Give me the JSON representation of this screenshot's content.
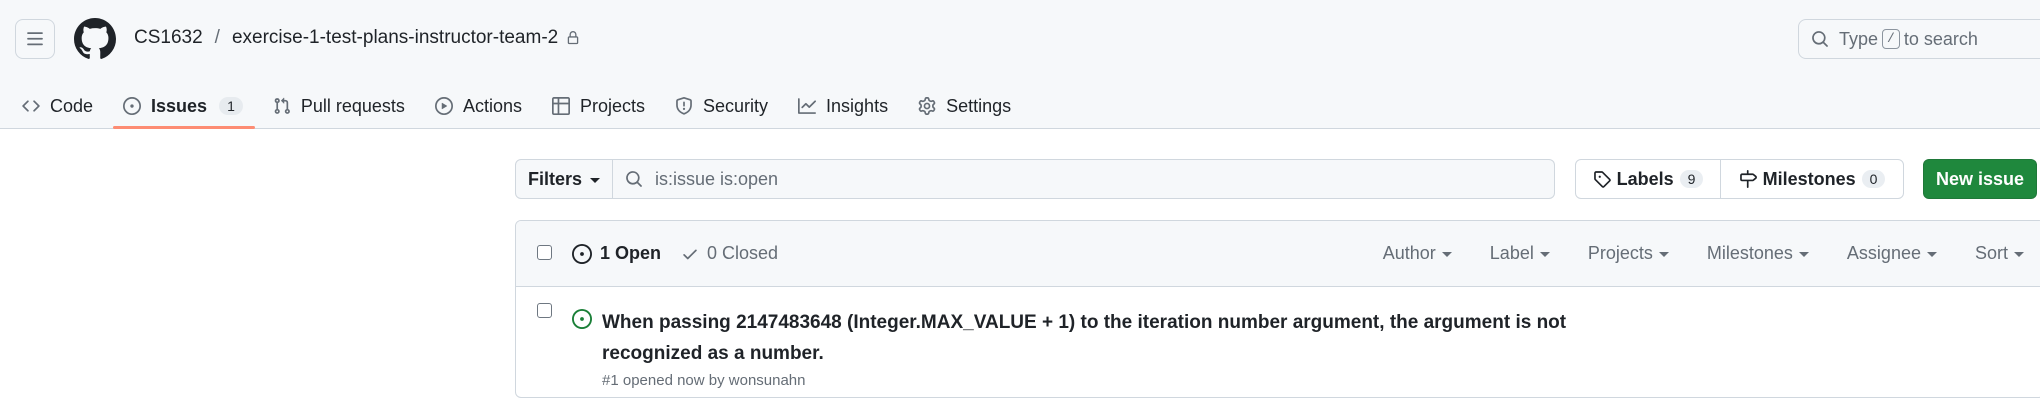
{
  "header": {
    "owner": "CS1632",
    "separator": "/",
    "repo": "exercise-1-test-plans-instructor-team-2",
    "search_placeholder_pre": "Type",
    "search_key": "/",
    "search_placeholder_post": "to search"
  },
  "tabs": [
    {
      "label": "Code",
      "icon": "code-icon"
    },
    {
      "label": "Issues",
      "icon": "issue-opened-icon",
      "count": "1",
      "active": true
    },
    {
      "label": "Pull requests",
      "icon": "git-pull-request-icon"
    },
    {
      "label": "Actions",
      "icon": "play-icon"
    },
    {
      "label": "Projects",
      "icon": "table-icon"
    },
    {
      "label": "Security",
      "icon": "shield-icon"
    },
    {
      "label": "Insights",
      "icon": "graph-icon"
    },
    {
      "label": "Settings",
      "icon": "gear-icon"
    }
  ],
  "toolbar": {
    "filters_label": "Filters",
    "filter_query": "is:issue is:open",
    "labels_label": "Labels",
    "labels_count": "9",
    "milestones_label": "Milestones",
    "milestones_count": "0",
    "new_issue_label": "New issue"
  },
  "list": {
    "open_label": "1 Open",
    "closed_label": "0 Closed",
    "sorters": [
      "Author",
      "Label",
      "Projects",
      "Milestones",
      "Assignee",
      "Sort"
    ],
    "issues": [
      {
        "title": "When passing 2147483648 (Integer.MAX_VALUE + 1) to the iteration number argument, the argument is not recognized as a number.",
        "meta": "#1 opened now by wonsunahn"
      }
    ]
  },
  "colors": {
    "accent_underline": "#fd8c73",
    "new_issue_bg": "#1f883d",
    "open_icon": "#1a7f37"
  }
}
